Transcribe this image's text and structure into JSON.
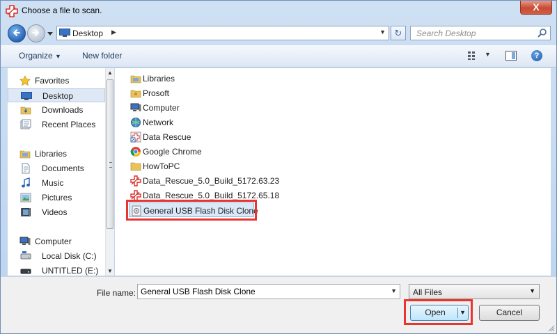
{
  "window": {
    "title": "Choose a file to scan.",
    "close_label": "X"
  },
  "address": {
    "location": "Desktop",
    "search_placeholder": "Search Desktop"
  },
  "toolbar": {
    "organize_label": "Organize",
    "new_folder_label": "New folder",
    "help_label": "?"
  },
  "sidebar": {
    "items": [
      {
        "label": "Favorites",
        "icon": "star-icon",
        "group": true
      },
      {
        "label": "Desktop",
        "icon": "desktop-icon",
        "selected": true
      },
      {
        "label": "Downloads",
        "icon": "downloads-icon"
      },
      {
        "label": "Recent Places",
        "icon": "recent-places-icon"
      },
      {
        "label": "Libraries",
        "icon": "libraries-icon",
        "group": true
      },
      {
        "label": "Documents",
        "icon": "documents-icon"
      },
      {
        "label": "Music",
        "icon": "music-icon"
      },
      {
        "label": "Pictures",
        "icon": "pictures-icon"
      },
      {
        "label": "Videos",
        "icon": "videos-icon"
      },
      {
        "label": "Computer",
        "icon": "computer-icon",
        "group": true
      },
      {
        "label": "Local Disk (C:)",
        "icon": "local-disk-icon"
      },
      {
        "label": "UNTITLED (E:)",
        "icon": "drive-icon"
      }
    ]
  },
  "files": [
    {
      "label": "Libraries",
      "icon": "libraries-folder-icon"
    },
    {
      "label": "Prosoft",
      "icon": "user-folder-icon"
    },
    {
      "label": "Computer",
      "icon": "computer-icon"
    },
    {
      "label": "Network",
      "icon": "network-icon"
    },
    {
      "label": "Data Rescue",
      "icon": "shortcut-icon"
    },
    {
      "label": "Google Chrome",
      "icon": "chrome-icon"
    },
    {
      "label": "HowToPC",
      "icon": "folder-icon"
    },
    {
      "label": "Data_Rescue_5.0_Build_5172.63.23",
      "icon": "data-rescue-icon"
    },
    {
      "label": "Data_Rescue_5.0_Build_5172.65.18",
      "icon": "data-rescue-icon"
    },
    {
      "label": "General USB Flash Disk Clone",
      "icon": "disk-clone-icon",
      "selected": true
    }
  ],
  "bottom": {
    "file_name_label": "File name:",
    "file_name_value": "General USB Flash Disk Clone",
    "filter_value": "All Files",
    "open_label": "Open",
    "cancel_label": "Cancel"
  },
  "colors": {
    "highlight": "#e8352d",
    "selection": "#dbe8f7"
  }
}
